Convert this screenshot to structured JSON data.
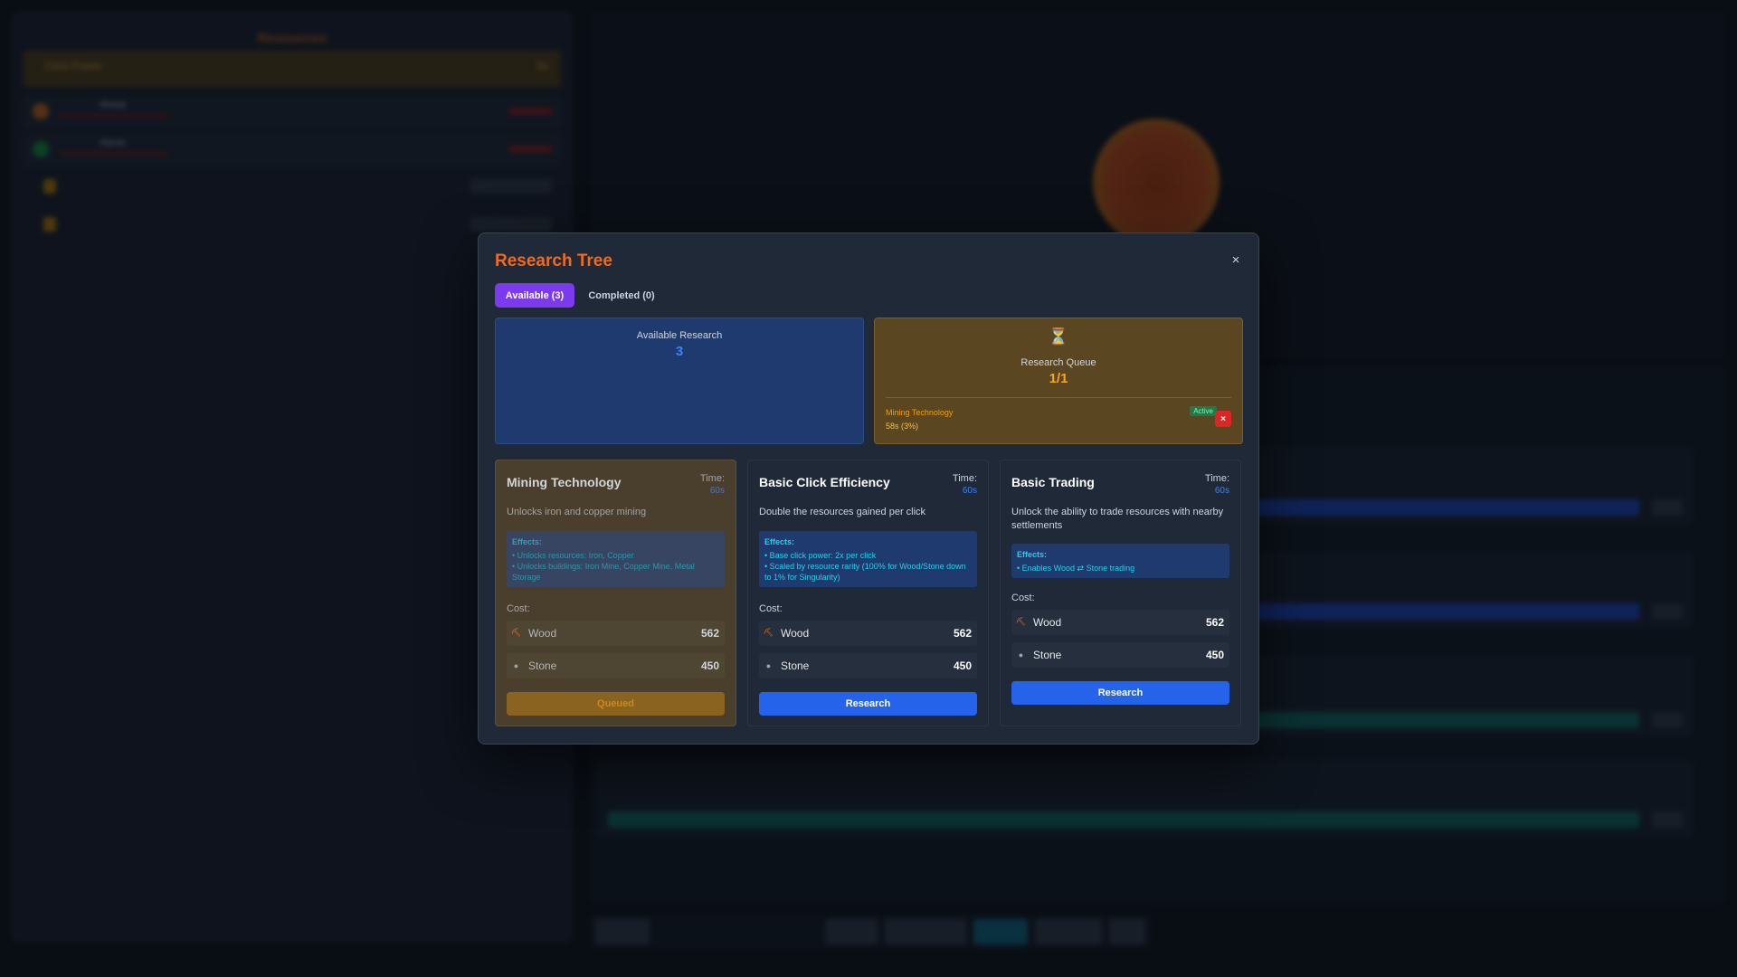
{
  "modal": {
    "title": "Research Tree",
    "close_label": "×",
    "tabs": [
      {
        "label": "Available (3)",
        "active": true
      },
      {
        "label": "Completed (0)",
        "active": false
      }
    ],
    "available_stat": {
      "label": "Available Research",
      "value": "3"
    },
    "queue_stat": {
      "icon": "⏳",
      "label": "Research Queue",
      "value": "1/1",
      "item": {
        "name": "Mining Technology",
        "time": "58s (3%)",
        "badge": "Active",
        "cancel_label": "×"
      }
    },
    "cards": [
      {
        "name": "Mining Technology",
        "time_label": "Time:",
        "time_value": "60s",
        "description": "Unlocks iron and copper mining",
        "effects_title": "Effects:",
        "effects": [
          "• Unlocks resources: Iron, Copper",
          "• Unlocks buildings: Iron Mine, Copper Mine, Metal Storage"
        ],
        "cost_label": "Cost:",
        "costs": [
          {
            "name": "Wood",
            "value": "562",
            "icon": "wood-icon"
          },
          {
            "name": "Stone",
            "value": "450",
            "icon": "stone-icon"
          }
        ],
        "button": "Queued",
        "state": "queued"
      },
      {
        "name": "Basic Click Efficiency",
        "time_label": "Time:",
        "time_value": "60s",
        "description": "Double the resources gained per click",
        "effects_title": "Effects:",
        "effects": [
          "• Base click power: 2x per click",
          "• Scaled by resource rarity (100% for Wood/Stone down to 1% for Singularity)"
        ],
        "cost_label": "Cost:",
        "costs": [
          {
            "name": "Wood",
            "value": "562",
            "icon": "wood-icon"
          },
          {
            "name": "Stone",
            "value": "450",
            "icon": "stone-icon"
          }
        ],
        "button": "Research",
        "state": "available"
      },
      {
        "name": "Basic Trading",
        "time_label": "Time:",
        "time_value": "60s",
        "description": "Unlock the ability to trade resources with nearby settlements",
        "effects_title": "Effects:",
        "effects": [
          "• Enables Wood ⇄ Stone trading"
        ],
        "cost_label": "Cost:",
        "costs": [
          {
            "name": "Wood",
            "value": "562",
            "icon": "wood-icon"
          },
          {
            "name": "Stone",
            "value": "450",
            "icon": "stone-icon"
          }
        ],
        "button": "Research",
        "state": "available"
      }
    ]
  },
  "background": {
    "resources_title": "Resources",
    "click_power_label": "Click Power",
    "click_power_value": "5x",
    "resources": [
      {
        "name": "Wood"
      },
      {
        "name": "Stone"
      }
    ]
  },
  "colors": {
    "accent_orange": "#f06a1f",
    "tab_active": "#7c3aed",
    "research_button": "#2563eb",
    "queued_button": "#8a6320"
  }
}
